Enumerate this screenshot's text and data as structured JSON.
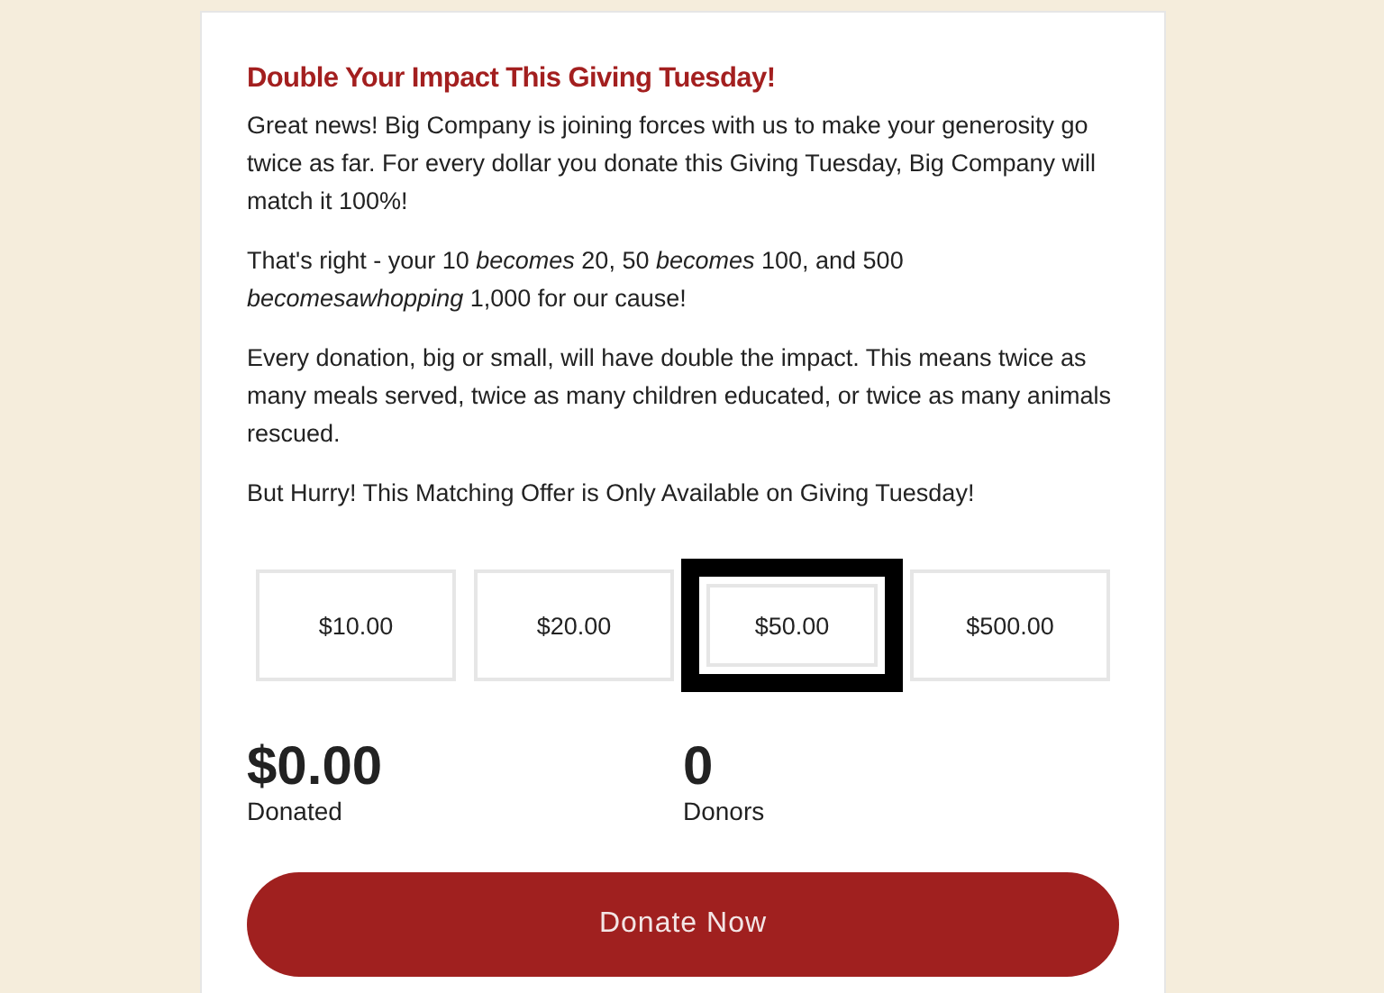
{
  "heading": "Double Your Impact This Giving Tuesday!",
  "paragraphs": [
    "Great news! Big Company is joining forces with us to make your generosity go twice as far. For every dollar you donate this Giving Tuesday, Big Company will match it 100%!",
    "That's right - your 10 *becomes* 20, 50 *becomes* 100, and 500 *becomesawhopping* 1,000 for our cause!",
    "Every donation, big or small, will have double the impact. This means twice as many meals served, twice as many children educated, or twice as many animals rescued.",
    "But Hurry! This Matching Offer is Only Available on Giving Tuesday!"
  ],
  "amounts": [
    {
      "label": "$10.00",
      "selected": false
    },
    {
      "label": "$20.00",
      "selected": false
    },
    {
      "label": "$50.00",
      "selected": true
    },
    {
      "label": "$500.00",
      "selected": false
    }
  ],
  "stats": [
    {
      "value": "$0.00",
      "label": "Donated"
    },
    {
      "value": "0",
      "label": "Donors"
    }
  ],
  "donate_button": "Donate Now"
}
